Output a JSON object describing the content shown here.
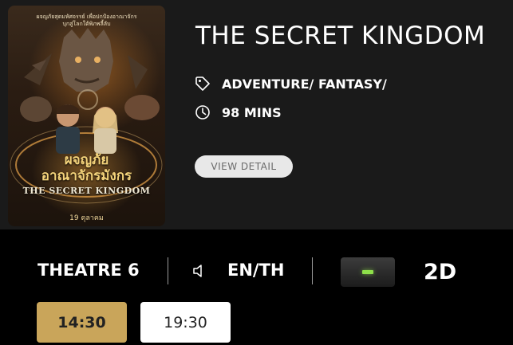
{
  "movie": {
    "title": "THE SECRET KINGDOM",
    "genre": "ADVENTURE/ FANTASY/",
    "duration": "98 MINS",
    "view_detail_label": "VIEW DETAIL",
    "poster": {
      "thai_tagline_1": "ผจญภัยสุดมหัศจรรย์ เพื่อปกป้องอาณาจักร",
      "thai_tagline_2": "บุกสู่โลกใต้พิภพลี้ลับ",
      "thai_title_1": "ผจญภัย",
      "thai_title_2": "อาณาจักรมังกร",
      "english_title": "THE SECRET KINGDOM",
      "release_date": "19 ตุลาคม"
    }
  },
  "session": {
    "theatre": "THEATRE 6",
    "language": "EN/TH",
    "format": "2D"
  },
  "showtimes": [
    {
      "time": "14:30",
      "selected": true
    },
    {
      "time": "19:30",
      "selected": false
    }
  ],
  "colors": {
    "panel_bg": "#1a1a1a",
    "page_bg": "#000000",
    "selected_showtime": "#c9a55a",
    "format_indicator": "#8ee04a",
    "view_detail_bg": "#e8e8e8"
  },
  "icons": {
    "genre": "tag-icon",
    "duration": "clock-icon",
    "language": "speaker-icon"
  }
}
